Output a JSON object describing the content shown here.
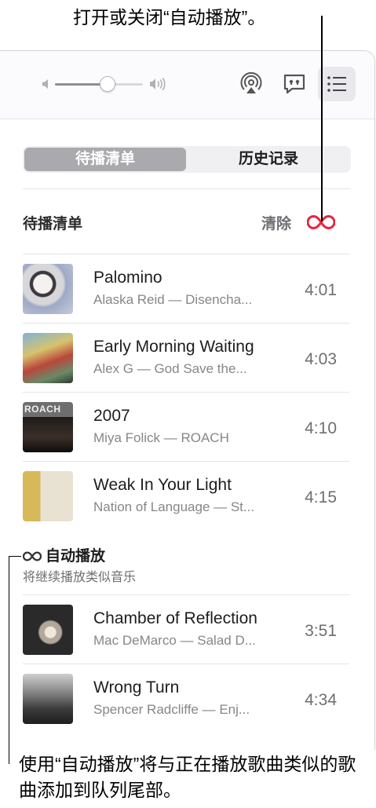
{
  "callouts": {
    "top": "打开或关闭“自动播放”。",
    "bottom": "使用“自动播放”将与正在播放歌曲类似的歌曲添加到队列尾部。"
  },
  "toolbar": {
    "volume_level": 0.6,
    "icons": [
      "volume-low-icon",
      "volume-high-icon",
      "airplay-icon",
      "lyrics-icon",
      "queue-list-icon"
    ]
  },
  "segmented": {
    "active": "待播清单",
    "inactive": "历史记录"
  },
  "queue": {
    "header": "待播清单",
    "clear_label": "清除",
    "autoplay_icon": "infinity-icon",
    "accent_color": "#e8253d",
    "tracks": [
      {
        "title": "Palomino",
        "subtitle": "Alaska Reid — Disencha...",
        "duration": "4:01"
      },
      {
        "title": "Early Morning Waiting",
        "subtitle": "Alex G — God Save the...",
        "duration": "4:03"
      },
      {
        "title": "2007",
        "subtitle": "Miya Folick — ROACH",
        "duration": "4:10",
        "art_text": "ROACH"
      },
      {
        "title": "Weak In Your Light",
        "subtitle": "Nation of Language — St...",
        "duration": "4:15"
      }
    ]
  },
  "autoplay": {
    "title": "自动播放",
    "subtitle": "将继续播放类似音乐",
    "tracks": [
      {
        "title": "Chamber of Reflection",
        "subtitle": "Mac DeMarco — Salad D...",
        "duration": "3:51"
      },
      {
        "title": "Wrong Turn",
        "subtitle": "Spencer Radcliffe — Enj...",
        "duration": "4:34"
      }
    ]
  }
}
